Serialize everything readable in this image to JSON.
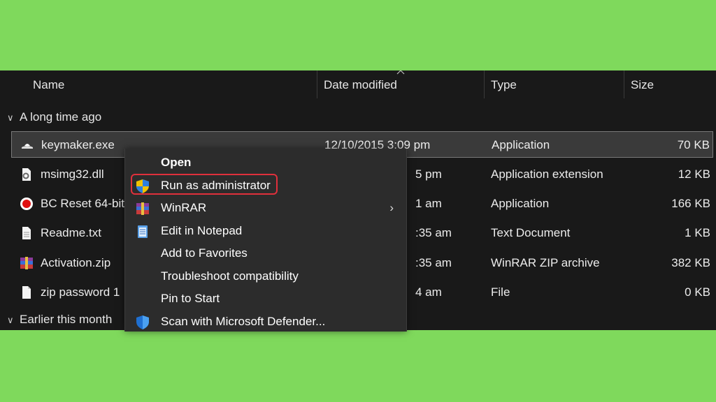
{
  "columns": {
    "name": "Name",
    "date_modified": "Date modified",
    "type": "Type",
    "size": "Size"
  },
  "groups": {
    "long_ago": "A long time ago",
    "earlier_month": "Earlier this month"
  },
  "files": [
    {
      "name": "keymaker.exe",
      "date": "12/10/2015 3:09 pm",
      "type": "Application",
      "size": "70 KB",
      "icon": "keymaker-app-icon"
    },
    {
      "name": "msimg32.dll",
      "date": "5 pm",
      "type": "Application extension",
      "size": "12 KB",
      "icon": "dll-gear-icon"
    },
    {
      "name": "BC Reset 64-bit",
      "date": "1 am",
      "type": "Application",
      "size": "166 KB",
      "icon": "record-red-icon"
    },
    {
      "name": "Readme.txt",
      "date": ":35 am",
      "type": "Text Document",
      "size": "1 KB",
      "icon": "text-document-icon"
    },
    {
      "name": "Activation.zip",
      "date": ":35 am",
      "type": "WinRAR ZIP archive",
      "size": "382 KB",
      "icon": "winrar-archive-icon"
    },
    {
      "name": "zip password 1",
      "date": "4 am",
      "type": "File",
      "size": "0 KB",
      "icon": "blank-file-icon"
    }
  ],
  "context_menu": {
    "open": "Open",
    "run_as_admin": "Run as administrator",
    "winrar": "WinRAR",
    "winrar_arrow": "›",
    "edit_notepad": "Edit in Notepad",
    "add_favorites": "Add to Favorites",
    "troubleshoot": "Troubleshoot compatibility",
    "pin_start": "Pin to Start",
    "scan_defender": "Scan with Microsoft Defender..."
  },
  "colors": {
    "background": "#7fd95c",
    "explorer_bg": "#191919",
    "menu_bg": "#2c2c2c",
    "highlight": "#e0303c"
  }
}
